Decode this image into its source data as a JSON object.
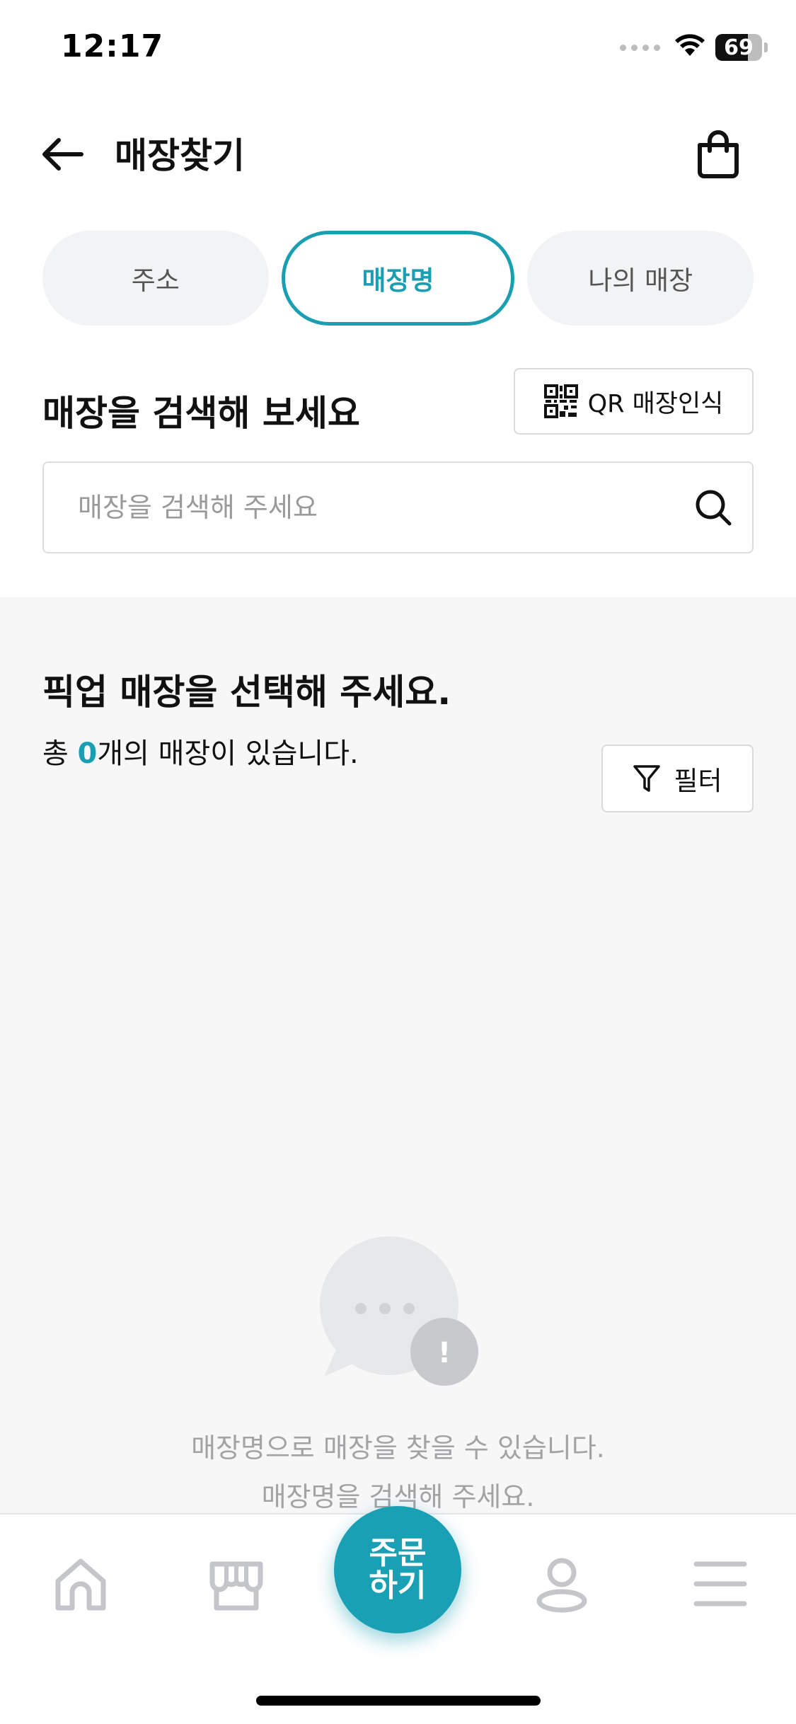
{
  "status_bar": {
    "time": "12:17",
    "battery": "69",
    "battery_level": 0.69
  },
  "header": {
    "title": "매장찾기"
  },
  "tabs": [
    {
      "label": "주소",
      "active": false
    },
    {
      "label": "매장명",
      "active": true
    },
    {
      "label": "나의 매장",
      "active": false
    }
  ],
  "search": {
    "heading": "매장을 검색해 보세요",
    "qr_label": "QR 매장인식",
    "placeholder": "매장을 검색해 주세요",
    "value": ""
  },
  "results": {
    "title": "픽업 매장을 선택해 주세요.",
    "count_prefix": "총 ",
    "count": "0",
    "count_suffix": "개의 매장이 있습니다.",
    "filter_label": "필터",
    "empty_line1": "매장명으로 매장을 찾을 수 있습니다.",
    "empty_line2": "매장명을 검색해 주세요."
  },
  "bottom_nav": {
    "order_line1": "주문",
    "order_line2": "하기",
    "items": [
      "home-icon",
      "store-icon",
      "order-button",
      "profile-icon",
      "menu-icon"
    ]
  },
  "colors": {
    "accent": "#1a9fb2",
    "tab_inactive_bg": "#f2f3f5",
    "results_bg": "#f7f7f8",
    "muted_text": "#a3a3a6"
  }
}
